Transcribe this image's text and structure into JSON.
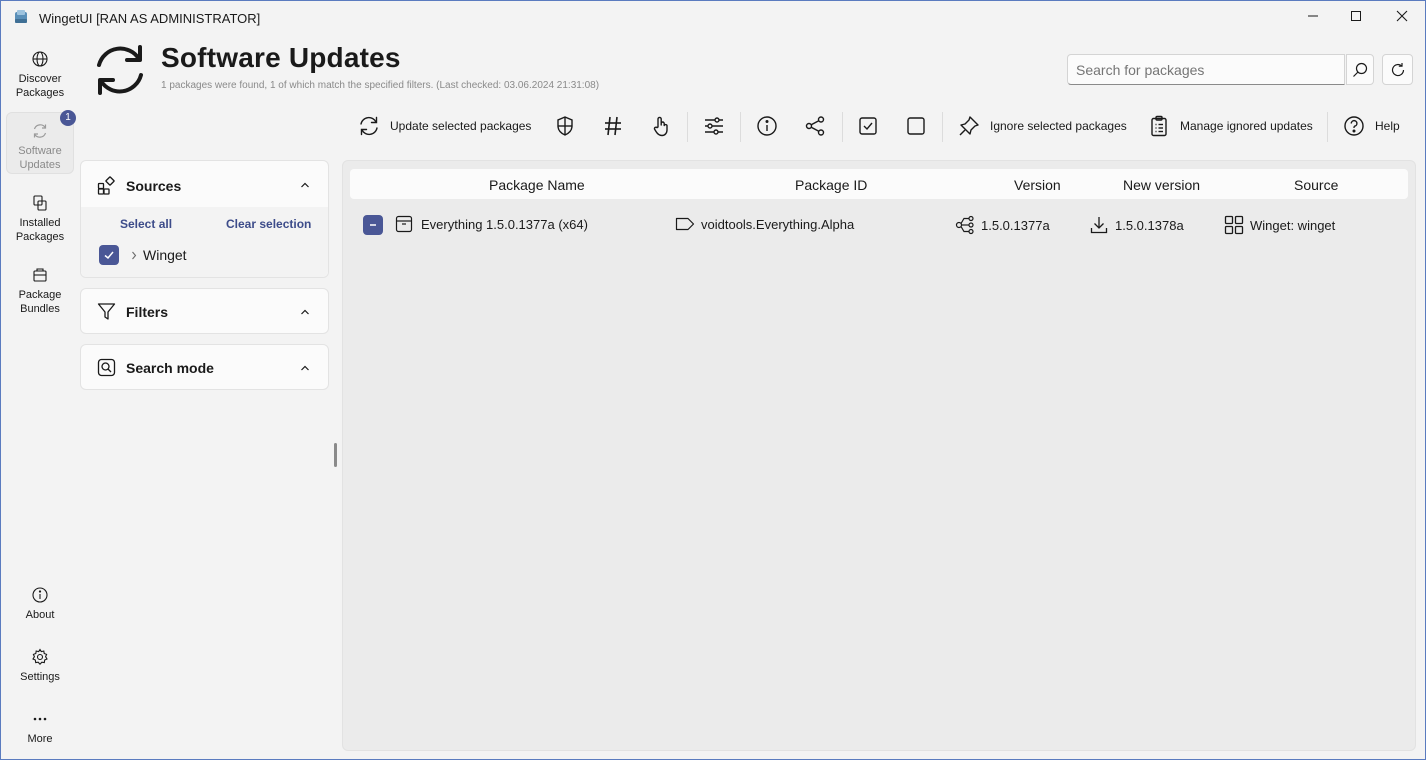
{
  "window": {
    "title": "WingetUI [RAN AS ADMINISTRATOR]",
    "controls": [
      "minimize",
      "maximize",
      "close"
    ]
  },
  "nav": {
    "discover": {
      "label_line1": "Discover",
      "label_line2": "Packages"
    },
    "updates": {
      "label_line1": "Software",
      "label_line2": "Updates",
      "badge": "1"
    },
    "installed": {
      "label_line1": "Installed",
      "label_line2": "Packages"
    },
    "bundles": {
      "label_line1": "Package",
      "label_line2": "Bundles"
    },
    "about": {
      "label": "About"
    },
    "settings": {
      "label": "Settings"
    },
    "more": {
      "label": "More"
    }
  },
  "header": {
    "title": "Software Updates",
    "subtitle": "1 packages were found, 1 of which match the specified filters. (Last checked: 03.06.2024 21:31:08)"
  },
  "search": {
    "placeholder": "Search for packages"
  },
  "toolbar": {
    "update_selected": "Update selected packages",
    "ignore_selected": "Ignore selected packages",
    "manage_ignored": "Manage ignored updates",
    "help": "Help"
  },
  "sidebar": {
    "sources": {
      "title": "Sources",
      "select_all": "Select all",
      "clear_selection": "Clear selection",
      "items": [
        {
          "label": "Winget",
          "checked": true
        }
      ]
    },
    "filters": {
      "title": "Filters"
    },
    "search_mode": {
      "title": "Search mode"
    }
  },
  "table": {
    "columns": [
      "Package Name",
      "Package ID",
      "Version",
      "New version",
      "Source"
    ],
    "rows": [
      {
        "name": "Everything 1.5.0.1377a (x64)",
        "id": "voidtools.Everything.Alpha",
        "version": "1.5.0.1377a",
        "new_version": "1.5.0.1378a",
        "source": "Winget: winget"
      }
    ]
  },
  "colors": {
    "accent": "#4a5796",
    "link": "#3d4c8a",
    "background": "#f3f3f3"
  }
}
